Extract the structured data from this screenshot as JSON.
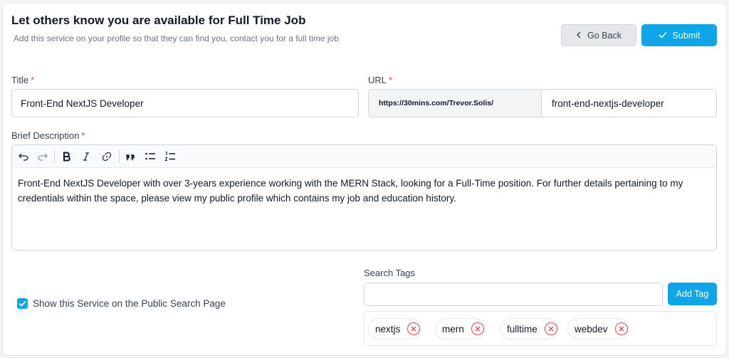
{
  "header": {
    "title": "Let others know you are available for Full Time Job",
    "subtitle": "Add this service on your profile so that they can find you, contact you for a full time job"
  },
  "actions": {
    "back_label": "Go Back",
    "submit_label": "Submit"
  },
  "form": {
    "title_label": "Title",
    "title_value": "Front-End NextJS Developer",
    "url_label": "URL",
    "url_prefix": "https://30mins.com/Trevor.Solis/",
    "url_slug": "front-end-nextjs-developer",
    "required_marker": "*",
    "description_label": "Brief Description",
    "description_value": "Front-End NextJS Developer with over 3-years experience working with the MERN Stack, looking for a Full-Time position. For further details pertaining to my credentials within the space, please view my public profile which contains my job and education history.",
    "show_public_label": "Show this Service on the Public Search Page",
    "show_public_checked": true,
    "search_tags_label": "Search Tags",
    "tag_input_value": "",
    "add_tag_label": "Add Tag",
    "tags": [
      "nextjs",
      "mern",
      "fulltime",
      "webdev"
    ]
  },
  "toolbar_icons": [
    "undo-icon",
    "redo-icon",
    "bold-icon",
    "italic-icon",
    "link-icon",
    "quote-icon",
    "bullet-list-icon",
    "numbered-list-icon"
  ],
  "colors": {
    "accent": "#0ea5e9",
    "required": "#ef4444",
    "remove_tag": "#ef4444"
  }
}
